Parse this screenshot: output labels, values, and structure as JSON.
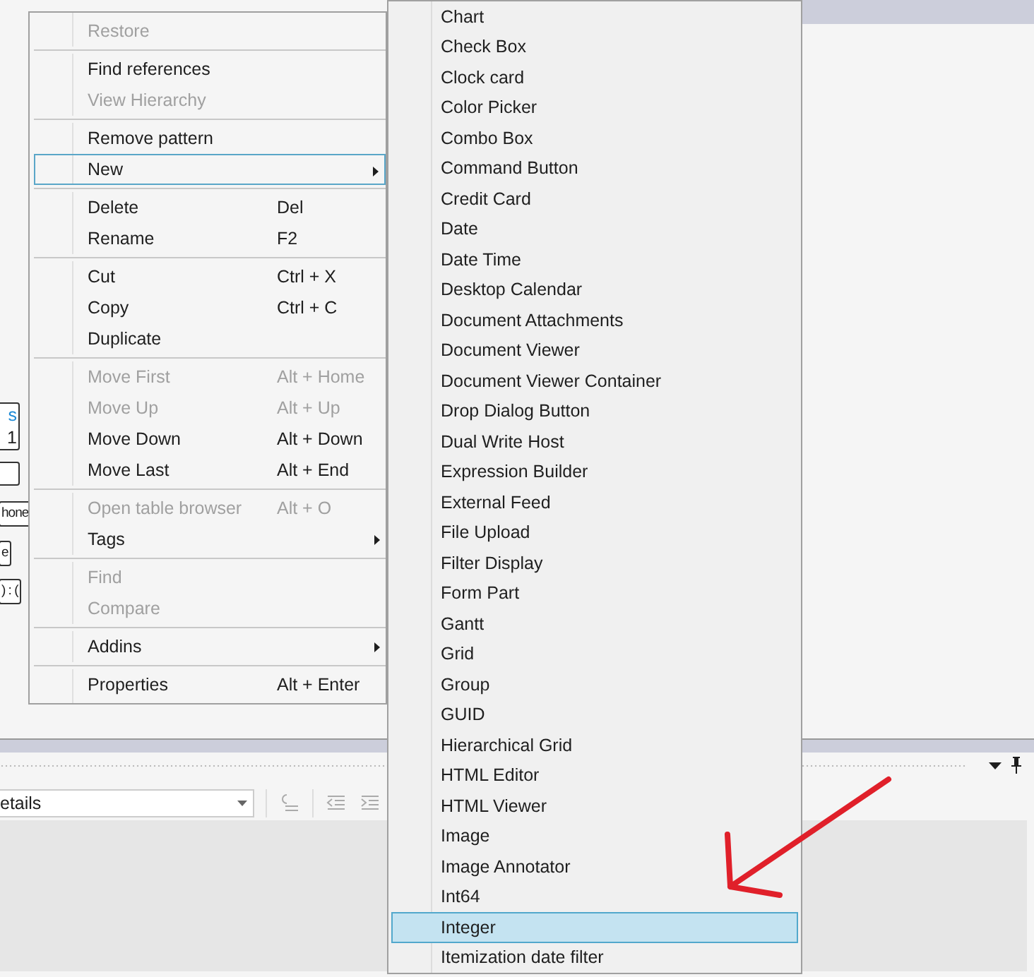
{
  "diagram_nodes": [
    {
      "kind": "text",
      "lines": [
        {
          "text": "s",
          "kind": "link"
        },
        {
          "text": "1",
          "kind": "plain"
        }
      ]
    },
    {
      "kind": "box"
    },
    {
      "kind": "text",
      "lines": [
        {
          "text": "hone",
          "kind": "plain"
        }
      ]
    },
    {
      "kind": "text",
      "lines": [
        {
          "text": "e",
          "kind": "plain"
        }
      ]
    },
    {
      "kind": "text",
      "lines": [
        {
          "text": ") : (",
          "kind": "plain"
        }
      ]
    }
  ],
  "context_menu": {
    "items": [
      {
        "kind": "item",
        "label": "Restore",
        "disabled": true,
        "selected": false,
        "has_submenu": false
      },
      {
        "kind": "separator"
      },
      {
        "kind": "item",
        "label": "Find references",
        "disabled": false,
        "selected": false,
        "has_submenu": false
      },
      {
        "kind": "item",
        "label": "View Hierarchy",
        "disabled": true,
        "selected": false,
        "has_submenu": false
      },
      {
        "kind": "separator"
      },
      {
        "kind": "item",
        "label": "Remove pattern",
        "disabled": false,
        "selected": false,
        "has_submenu": false
      },
      {
        "kind": "item",
        "label": "New",
        "disabled": false,
        "selected": true,
        "has_submenu": true
      },
      {
        "kind": "separator"
      },
      {
        "kind": "item",
        "label": "Delete",
        "shortcut": "Del",
        "disabled": false,
        "selected": false,
        "has_submenu": false
      },
      {
        "kind": "item",
        "label": "Rename",
        "shortcut": "F2",
        "disabled": false,
        "selected": false,
        "has_submenu": false
      },
      {
        "kind": "separator"
      },
      {
        "kind": "item",
        "label": "Cut",
        "shortcut": "Ctrl + X",
        "disabled": false,
        "selected": false,
        "has_submenu": false
      },
      {
        "kind": "item",
        "label": "Copy",
        "shortcut": "Ctrl + C",
        "disabled": false,
        "selected": false,
        "has_submenu": false
      },
      {
        "kind": "item",
        "label": "Duplicate",
        "disabled": false,
        "selected": false,
        "has_submenu": false
      },
      {
        "kind": "separator"
      },
      {
        "kind": "item",
        "label": "Move First",
        "shortcut": "Alt + Home",
        "disabled": true,
        "selected": false,
        "has_submenu": false
      },
      {
        "kind": "item",
        "label": "Move Up",
        "shortcut": "Alt + Up",
        "disabled": true,
        "selected": false,
        "has_submenu": false
      },
      {
        "kind": "item",
        "label": "Move Down",
        "shortcut": "Alt + Down",
        "disabled": false,
        "selected": false,
        "has_submenu": false
      },
      {
        "kind": "item",
        "label": "Move Last",
        "shortcut": "Alt + End",
        "disabled": false,
        "selected": false,
        "has_submenu": false
      },
      {
        "kind": "separator"
      },
      {
        "kind": "item",
        "label": "Open table browser",
        "shortcut": "Alt + O",
        "disabled": true,
        "selected": false,
        "has_submenu": false
      },
      {
        "kind": "item",
        "label": "Tags",
        "disabled": false,
        "selected": false,
        "has_submenu": true
      },
      {
        "kind": "separator"
      },
      {
        "kind": "item",
        "label": "Find",
        "disabled": true,
        "selected": false,
        "has_submenu": false
      },
      {
        "kind": "item",
        "label": "Compare",
        "disabled": true,
        "selected": false,
        "has_submenu": false
      },
      {
        "kind": "separator"
      },
      {
        "kind": "item",
        "label": "Addins",
        "disabled": false,
        "selected": false,
        "has_submenu": true
      },
      {
        "kind": "separator"
      },
      {
        "kind": "item",
        "label": "Properties",
        "shortcut": "Alt + Enter",
        "disabled": false,
        "selected": false,
        "has_submenu": false
      }
    ]
  },
  "submenu": {
    "items": [
      {
        "label": "Chart",
        "selected": false
      },
      {
        "label": "Check Box",
        "selected": false
      },
      {
        "label": "Clock card",
        "selected": false
      },
      {
        "label": "Color Picker",
        "selected": false
      },
      {
        "label": "Combo Box",
        "selected": false
      },
      {
        "label": "Command Button",
        "selected": false
      },
      {
        "label": "Credit Card",
        "selected": false
      },
      {
        "label": "Date",
        "selected": false
      },
      {
        "label": "Date Time",
        "selected": false
      },
      {
        "label": "Desktop Calendar",
        "selected": false
      },
      {
        "label": "Document Attachments",
        "selected": false
      },
      {
        "label": "Document Viewer",
        "selected": false
      },
      {
        "label": "Document Viewer Container",
        "selected": false
      },
      {
        "label": "Drop Dialog Button",
        "selected": false
      },
      {
        "label": "Dual Write Host",
        "selected": false
      },
      {
        "label": "Expression Builder",
        "selected": false
      },
      {
        "label": "External Feed",
        "selected": false
      },
      {
        "label": "File Upload",
        "selected": false
      },
      {
        "label": "Filter Display",
        "selected": false
      },
      {
        "label": "Form Part",
        "selected": false
      },
      {
        "label": "Gantt",
        "selected": false
      },
      {
        "label": "Grid",
        "selected": false
      },
      {
        "label": "Group",
        "selected": false
      },
      {
        "label": "GUID",
        "selected": false
      },
      {
        "label": "Hierarchical Grid",
        "selected": false
      },
      {
        "label": "HTML Editor",
        "selected": false
      },
      {
        "label": "HTML Viewer",
        "selected": false
      },
      {
        "label": "Image",
        "selected": false
      },
      {
        "label": "Image Annotator",
        "selected": false
      },
      {
        "label": "Int64",
        "selected": false
      },
      {
        "label": "Integer",
        "selected": true
      },
      {
        "label": "Itemization date filter",
        "selected": false
      }
    ]
  },
  "bottom_panel": {
    "dropdown": {
      "value": "etails"
    }
  },
  "annotations": [
    {
      "kind": "arrow"
    }
  ]
}
